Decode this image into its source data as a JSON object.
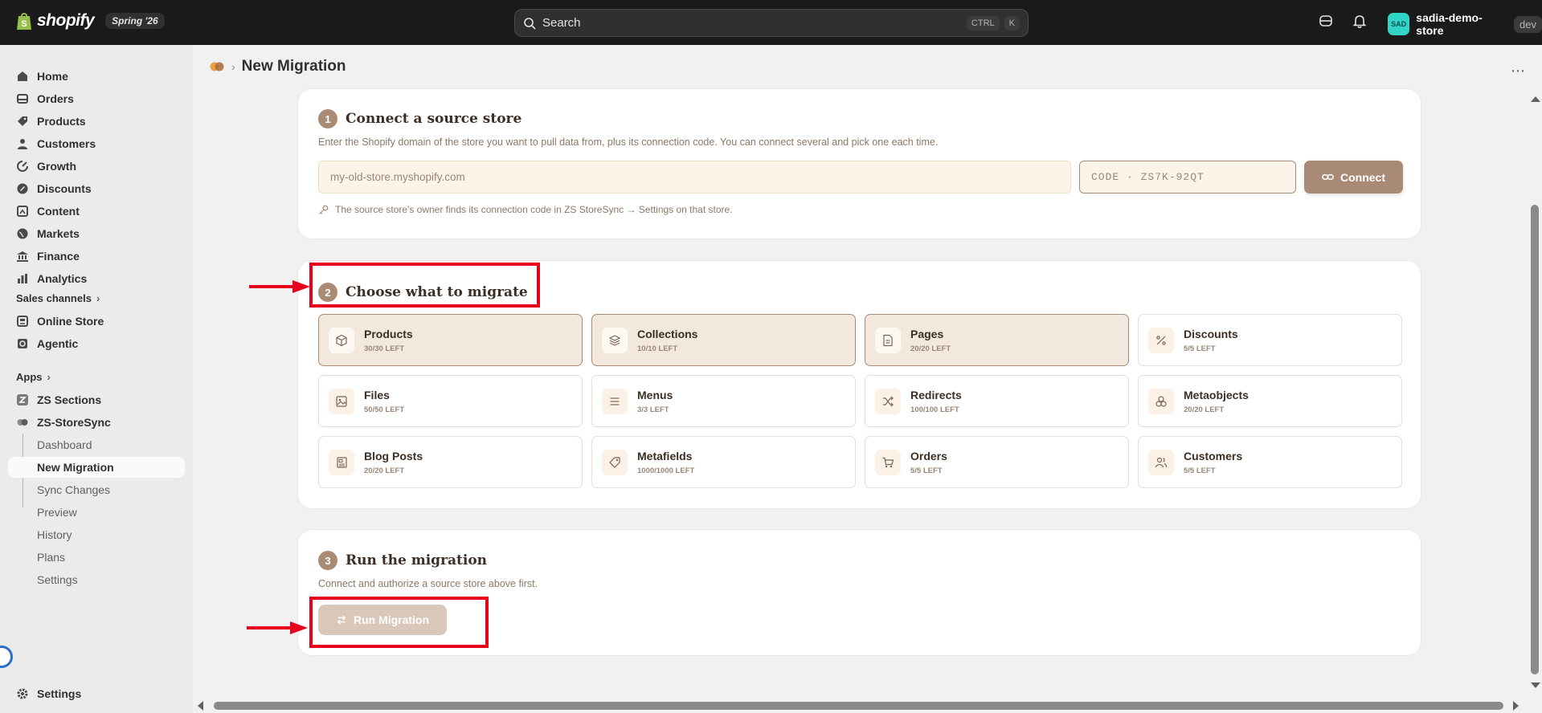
{
  "topbar": {
    "brand_name": "shopify",
    "edition_badge": "Spring '26",
    "search_placeholder": "Search",
    "shortcut_ctrl": "CTRL",
    "shortcut_k": "K",
    "store_avatar": "SAD",
    "store_name": "sadia-demo-store",
    "store_env": "dev"
  },
  "sidebar": {
    "main_items": [
      {
        "label": "Home",
        "icon": "home-icon"
      },
      {
        "label": "Orders",
        "icon": "orders-icon"
      },
      {
        "label": "Products",
        "icon": "tag-icon"
      },
      {
        "label": "Customers",
        "icon": "person-icon"
      },
      {
        "label": "Growth",
        "icon": "growth-icon"
      },
      {
        "label": "Discounts",
        "icon": "discount-icon"
      },
      {
        "label": "Content",
        "icon": "content-icon"
      },
      {
        "label": "Markets",
        "icon": "globe-icon"
      },
      {
        "label": "Finance",
        "icon": "bank-icon"
      },
      {
        "label": "Analytics",
        "icon": "chart-icon"
      }
    ],
    "sales_channels_heading": "Sales channels",
    "channels": [
      {
        "label": "Online Store",
        "icon": "store-icon"
      },
      {
        "label": "Agentic",
        "icon": "agentic-icon"
      }
    ],
    "apps_heading": "Apps",
    "apps": [
      {
        "label": "ZS Sections",
        "icon": "zs-sections-icon"
      },
      {
        "label": "ZS-StoreSync",
        "icon": "zs-storesync-icon"
      }
    ],
    "app_sub_items": [
      "Dashboard",
      "New Migration",
      "Sync Changes",
      "Preview",
      "History",
      "Plans",
      "Settings"
    ],
    "settings_label": "Settings"
  },
  "page": {
    "title": "New Migration",
    "more_label": "⋯"
  },
  "step1": {
    "number": "1",
    "title": "Connect a source store",
    "description": "Enter the Shopify domain of the store you want to pull data from, plus its connection code. You can connect several and pick one each time.",
    "domain_placeholder": "my-old-store.myshopify.com",
    "code_placeholder": "CODE · ZS7K-92QT",
    "connect_label": "Connect",
    "hint": "The source store's owner finds its connection code in ZS StoreSync → Settings on that store."
  },
  "step2": {
    "number": "2",
    "title": "Choose what to migrate",
    "tiles": [
      {
        "name": "Products",
        "left": "30/30 LEFT",
        "selected": true,
        "icon": "box-icon"
      },
      {
        "name": "Collections",
        "left": "10/10 LEFT",
        "selected": true,
        "icon": "layers-icon"
      },
      {
        "name": "Pages",
        "left": "20/20 LEFT",
        "selected": true,
        "icon": "page-icon"
      },
      {
        "name": "Discounts",
        "left": "5/5 LEFT",
        "selected": false,
        "icon": "percent-icon"
      },
      {
        "name": "Files",
        "left": "50/50 LEFT",
        "selected": false,
        "icon": "image-icon"
      },
      {
        "name": "Menus",
        "left": "3/3 LEFT",
        "selected": false,
        "icon": "menu-icon"
      },
      {
        "name": "Redirects",
        "left": "100/100 LEFT",
        "selected": false,
        "icon": "shuffle-icon"
      },
      {
        "name": "Metaobjects",
        "left": "20/20 LEFT",
        "selected": false,
        "icon": "cubes-icon"
      },
      {
        "name": "Blog Posts",
        "left": "20/20 LEFT",
        "selected": false,
        "icon": "newspaper-icon"
      },
      {
        "name": "Metafields",
        "left": "1000/1000 LEFT",
        "selected": false,
        "icon": "label-icon"
      },
      {
        "name": "Orders",
        "left": "5/5 LEFT",
        "selected": false,
        "icon": "cart-icon"
      },
      {
        "name": "Customers",
        "left": "5/5 LEFT",
        "selected": false,
        "icon": "users-icon"
      }
    ]
  },
  "step3": {
    "number": "3",
    "title": "Run the migration",
    "description": "Connect and authorize a source store above first.",
    "run_label": "Run Migration"
  },
  "colors": {
    "accent": "#a98b75",
    "annotation": "#e8001c",
    "topbar": "#1a1a1a"
  }
}
